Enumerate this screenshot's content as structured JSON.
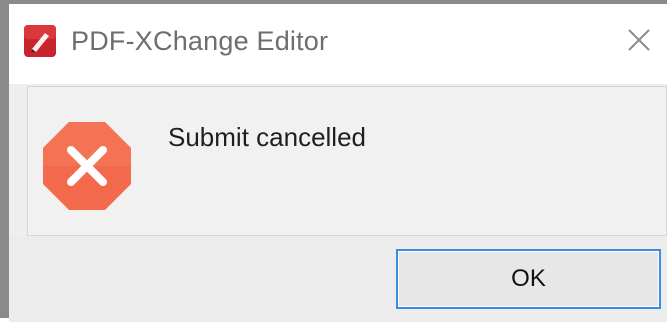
{
  "window": {
    "title": "PDF-XChange Editor",
    "app_icon": "pdf-xchange-logo-icon",
    "close_icon": "close-icon"
  },
  "dialog": {
    "icon": "error-icon",
    "message": "Submit cancelled",
    "ok_label": "OK"
  },
  "colors": {
    "error_icon": "#f26a4b",
    "app_icon": "#c8242b",
    "button_border": "#3b8be0"
  }
}
